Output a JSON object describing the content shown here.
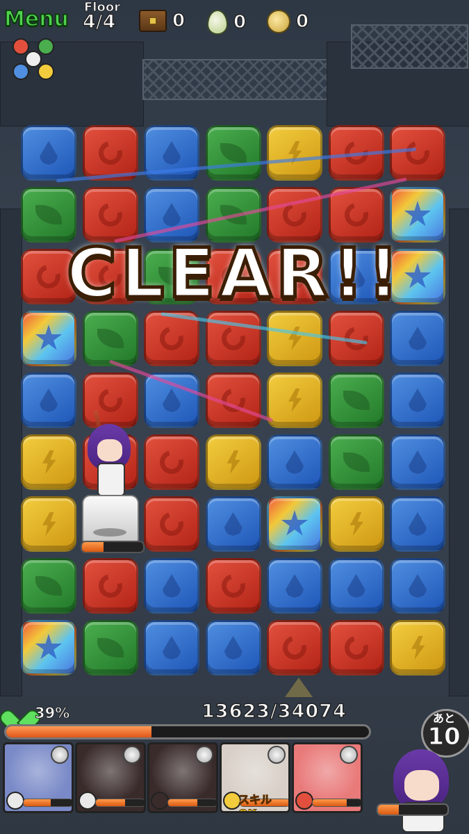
{
  "hud": {
    "menu_label": "Menu",
    "floor_label": "Floor",
    "floor_value": "4/4",
    "chest_count": "0",
    "egg_count": "0",
    "coin_count": "0"
  },
  "banner": {
    "text": "CLEAR!!"
  },
  "board": {
    "rows": [
      [
        "blue",
        "red",
        "blue",
        "green",
        "yellow",
        "red",
        "red"
      ],
      [
        "green",
        "red",
        "blue",
        "green",
        "red",
        "red",
        "rainbow"
      ],
      [
        "red",
        "red",
        "green",
        "red",
        "red",
        "blue",
        "rainbow"
      ],
      [
        "rainbow",
        "green",
        "red",
        "red",
        "yellow",
        "red",
        "blue"
      ],
      [
        "blue",
        "red",
        "blue",
        "red",
        "yellow",
        "green",
        "blue"
      ],
      [
        "yellow",
        "red",
        "red",
        "yellow",
        "blue",
        "green",
        "blue"
      ],
      [
        "yellow",
        "white",
        "red",
        "blue",
        "rainbow",
        "yellow",
        "blue"
      ],
      [
        "green",
        "red",
        "blue",
        "red",
        "blue",
        "blue",
        "blue"
      ],
      [
        "rainbow",
        "green",
        "blue",
        "blue",
        "red",
        "red",
        "yellow"
      ]
    ],
    "character_skill_charge": 0.35
  },
  "status": {
    "hp_percent": "39%",
    "hp_text": "13623/34074",
    "hp_value": 13623,
    "hp_max": 34074,
    "turns_label": "あと",
    "turns_value": "10"
  },
  "party": [
    {
      "name": "card-1",
      "attr_color": "#e9e9e9",
      "bg": "#7a8ac8",
      "charge": 0.55
    },
    {
      "name": "card-2",
      "attr_color": "#e9e9e9",
      "bg": "#3a2b2b",
      "charge": 0.6
    },
    {
      "name": "card-3",
      "attr_color": "#3a2b2b",
      "bg": "#3a2b2b",
      "charge": 0.6
    },
    {
      "name": "card-4",
      "attr_color": "#f2cc3d",
      "bg": "#d8d0c8",
      "charge": 1.0,
      "skill_label": "スキルOK"
    },
    {
      "name": "card-5",
      "attr_color": "#e2503d",
      "bg": "#e97a7a",
      "charge": 0.7
    }
  ],
  "leader_charge": 0.3,
  "colors": {
    "menu_green": "#4fd34f",
    "hp_orange": "#e0561a",
    "heart_green": "#5fe05f"
  }
}
